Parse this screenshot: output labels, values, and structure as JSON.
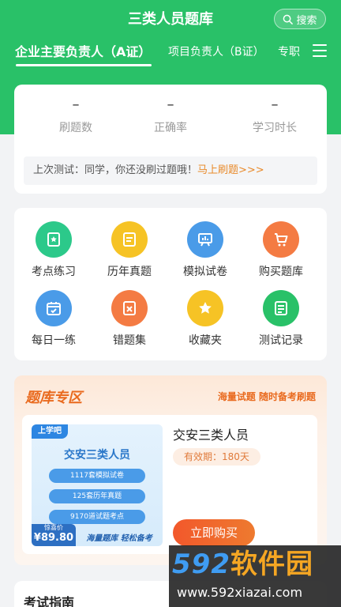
{
  "header": {
    "title": "三类人员题库",
    "search_label": "搜索",
    "tabs": [
      "企业主要负责人（A证）",
      "项目负责人（B证）",
      "专职"
    ]
  },
  "stats": {
    "items": [
      {
        "value": "–",
        "label": "刷题数"
      },
      {
        "value": "–",
        "label": "正确率"
      },
      {
        "value": "–",
        "label": "学习时长"
      }
    ],
    "last_test_text": "上次测试：同学，你还没刷过题哦！",
    "last_test_link": "马上刷题>>>"
  },
  "grid": [
    {
      "label": "考点练习",
      "icon": "star-book-icon",
      "color": "#2cc98a"
    },
    {
      "label": "历年真题",
      "icon": "document-icon",
      "color": "#f6c325"
    },
    {
      "label": "模拟试卷",
      "icon": "chart-board-icon",
      "color": "#4a9be8"
    },
    {
      "label": "购买题库",
      "icon": "cart-icon",
      "color": "#f47b43"
    },
    {
      "label": "每日一练",
      "icon": "calendar-check-icon",
      "color": "#4a9be8"
    },
    {
      "label": "错题集",
      "icon": "wrong-doc-icon",
      "color": "#f47b43"
    },
    {
      "label": "收藏夹",
      "icon": "star-icon",
      "color": "#f6c325"
    },
    {
      "label": "测试记录",
      "icon": "record-icon",
      "color": "#29c168"
    }
  ],
  "promo": {
    "title": "题库专区",
    "slogan": "海量试题 随时备考刷题",
    "product": {
      "name": "交安三类人员",
      "validity": "有效期：180天",
      "buy_label": "立即购买",
      "cover": {
        "logo": "上学吧",
        "title": "交安三类人员",
        "pills": [
          "1117套模拟试卷",
          "125套历年真题",
          "9170道试题考点"
        ],
        "price_label": "惊喜价",
        "price": "¥89.80",
        "bar_text": "海量题库 轻松备考"
      }
    }
  },
  "guide": {
    "title": "考试指南"
  },
  "watermark": {
    "brand_num": "592",
    "brand_cn": "软件园",
    "url": "www.592xiazai.com"
  }
}
